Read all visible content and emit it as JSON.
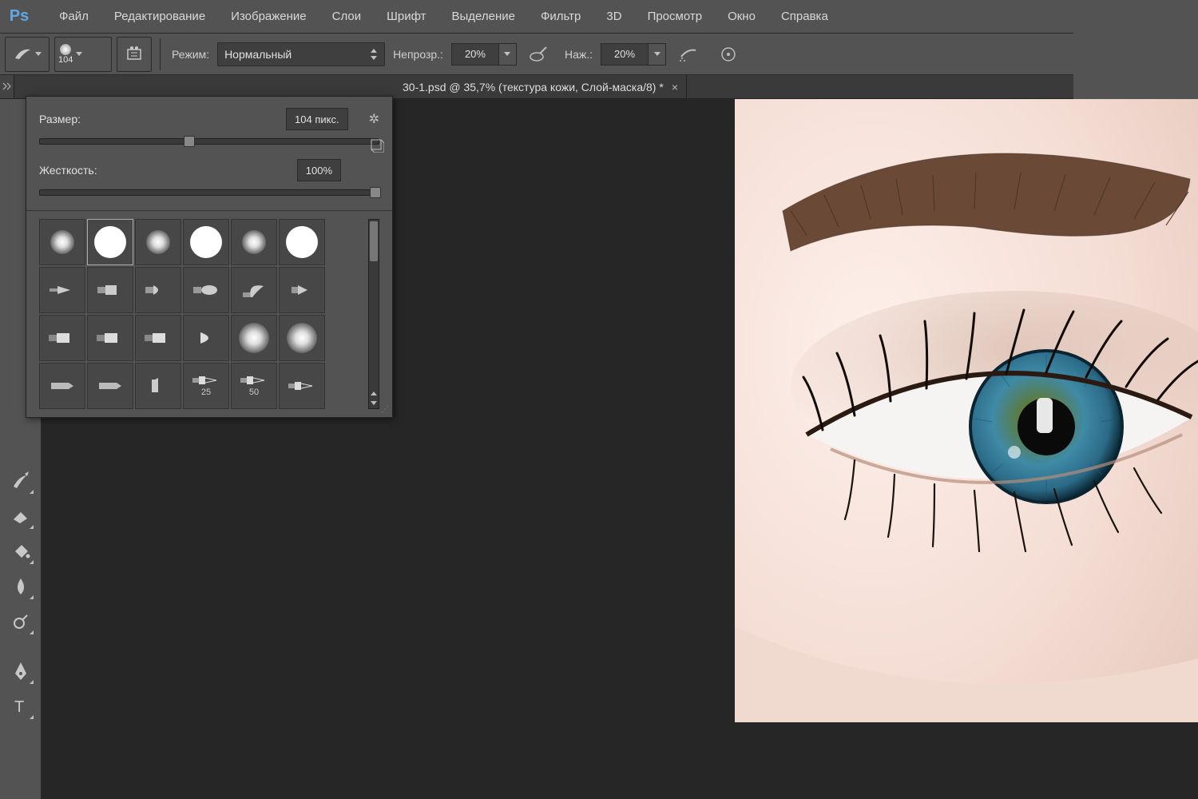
{
  "app": {
    "logo": "Ps"
  },
  "menu": {
    "items": [
      "Файл",
      "Редактирование",
      "Изображение",
      "Слои",
      "Шрифт",
      "Выделение",
      "Фильтр",
      "3D",
      "Просмотр",
      "Окно",
      "Справка"
    ]
  },
  "options": {
    "brush_size_indicator": "104",
    "mode_label": "Режим:",
    "mode_value": "Нормальный",
    "opacity_label": "Непрозр.:",
    "opacity_value": "20%",
    "flow_label": "Наж.:",
    "flow_value": "20%"
  },
  "tab": {
    "title": "30-1.psd @ 35,7% (текстура кожи, Слой-маска/8) *"
  },
  "brush_panel": {
    "size_label": "Размер:",
    "size_value": "104 пикс.",
    "size_slider_percent": 44,
    "hardness_label": "Жесткость:",
    "hardness_value": "100%",
    "hardness_slider_percent": 100,
    "preset_labels": [
      "25",
      "50"
    ]
  },
  "colors": {
    "bg": "#535353",
    "panel": "#3f3f3f",
    "canvas": "#262626",
    "accent": "#5fa8e6"
  }
}
